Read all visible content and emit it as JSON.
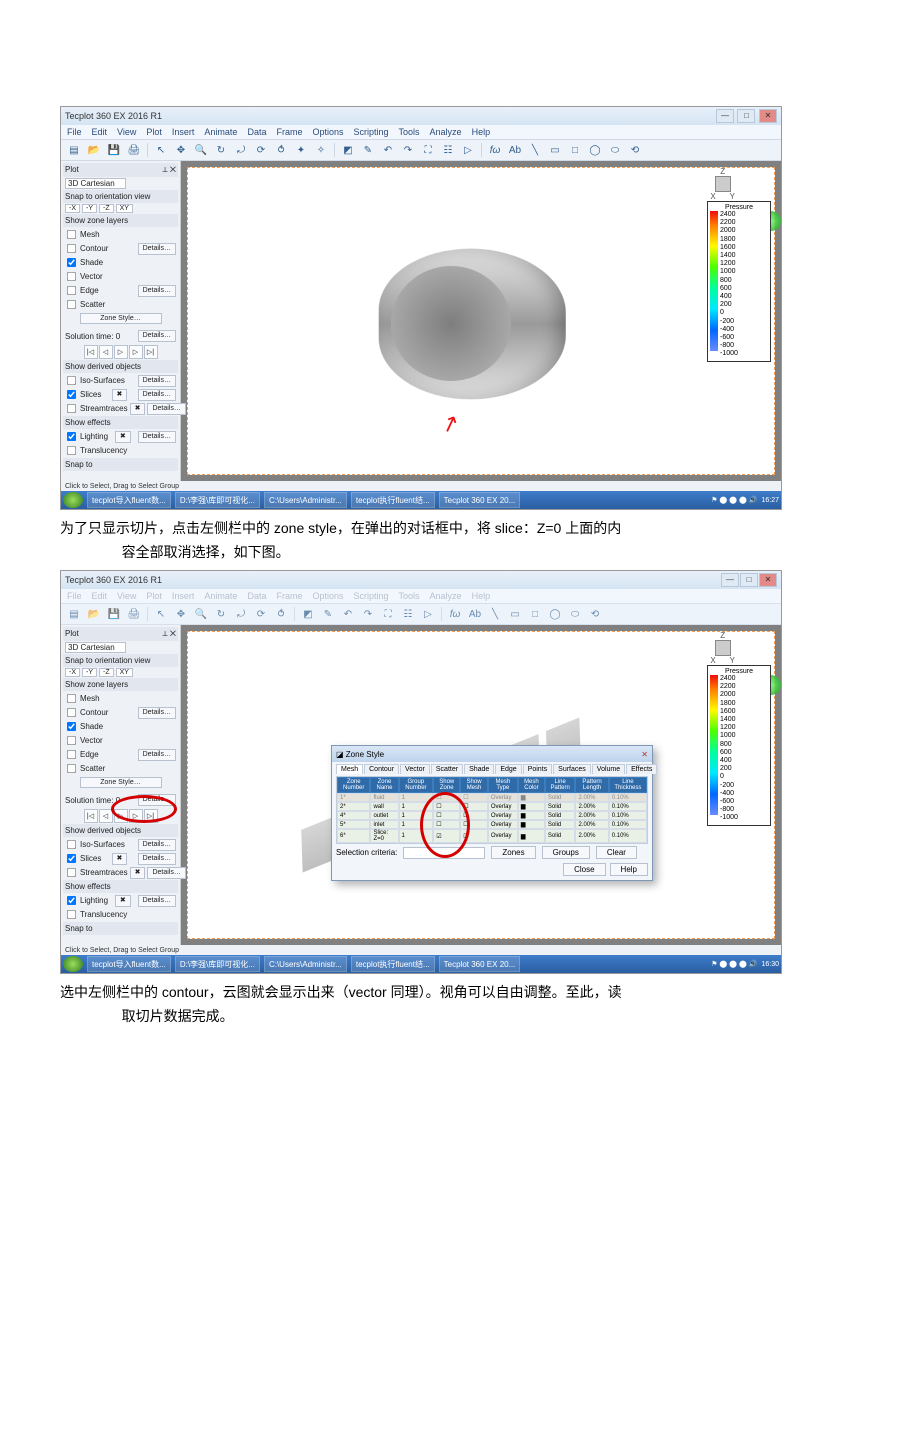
{
  "app": {
    "title": "Tecplot 360 EX 2016 R1"
  },
  "menus": [
    "File",
    "Edit",
    "View",
    "Plot",
    "Insert",
    "Animate",
    "Data",
    "Frame",
    "Options",
    "Scripting",
    "Tools",
    "Analyze",
    "Help"
  ],
  "sidebar": {
    "plot_panel": "Plot",
    "plot_type": "3D Cartesian",
    "snap_label": "Snap to orientation view",
    "orient": [
      "-X",
      "-Y",
      "-Z",
      "XY"
    ],
    "layers_hdr": "Show zone layers",
    "layers": [
      {
        "label": "Mesh",
        "checked": false,
        "details": false
      },
      {
        "label": "Contour",
        "checked": false,
        "details": true
      },
      {
        "label": "Shade",
        "checked": true,
        "details": false
      },
      {
        "label": "Vector",
        "checked": false,
        "details": false
      },
      {
        "label": "Edge",
        "checked": false,
        "details": true
      },
      {
        "label": "Scatter",
        "checked": false,
        "details": false
      }
    ],
    "zone_style_btn": "Zone Style…",
    "solution_time": "Solution time: 0",
    "details": "Details…",
    "derived_hdr": "Show derived objects",
    "derived": [
      {
        "label": "Iso-Surfaces",
        "checked": false
      },
      {
        "label": "Slices",
        "checked": true
      },
      {
        "label": "Streamtraces",
        "checked": false
      }
    ],
    "effects_hdr": "Show effects",
    "effects": [
      {
        "label": "Lighting",
        "checked": true
      },
      {
        "label": "Translucency",
        "checked": false
      }
    ],
    "snap_to": "Snap to"
  },
  "status": "Click to Select, Drag to Select Group",
  "taskbar_items": [
    "tecplot导入fluent数...",
    "D:\\李强\\库即可视化...",
    "C:\\Users\\Administr...",
    "tecplot执行fluent结...",
    "Tecplot 360 EX 20..."
  ],
  "times": [
    "16:27",
    "16:30"
  ],
  "legend": {
    "title": "Pressure",
    "ticks": [
      "2400",
      "2200",
      "2000",
      "1800",
      "1600",
      "1400",
      "1200",
      "1000",
      "800",
      "600",
      "400",
      "200",
      "0",
      "-200",
      "-400",
      "-600",
      "-800",
      "-1000"
    ]
  },
  "axes": {
    "z": "Z",
    "y": "Y",
    "x": "X"
  },
  "caption1_a": "为了只显示切片，点击左侧栏中的 zone style，在弹出的对话框中，将 slice：Z=0 上面的内",
  "caption1_b": "容全部取消选择，如下图。",
  "caption2_a": "选中左侧栏中的 contour，云图就会显示出来（vector 同理）。视角可以自由调整。至此，读",
  "caption2_b": "取切片数据完成。",
  "zone_style": {
    "title": "Zone Style",
    "tabs": [
      "Mesh",
      "Contour",
      "Vector",
      "Scatter",
      "Shade",
      "Edge",
      "Points",
      "Surfaces",
      "Volume",
      "Effects"
    ],
    "headers": [
      "Zone Number",
      "Zone Name",
      "Group Number",
      "Show Zone",
      "Show Mesh",
      "Mesh Type",
      "Mesh Color",
      "Line Pattern",
      "Pattern Length",
      "Line Thickness"
    ],
    "rows": [
      {
        "num": "1*",
        "name": "fluid",
        "grp": "1",
        "show": "",
        "mesh": "",
        "type": "Overlay",
        "color": "",
        "pat": "Solid",
        "len": "2.00%",
        "thk": "0.10%",
        "dim": true
      },
      {
        "num": "2*",
        "name": "wall",
        "grp": "1",
        "show": "",
        "mesh": "",
        "type": "Overlay",
        "color": "",
        "pat": "Solid",
        "len": "2.00%",
        "thk": "0.10%",
        "dim": false
      },
      {
        "num": "4*",
        "name": "outlet",
        "grp": "1",
        "show": "",
        "mesh": "",
        "type": "Overlay",
        "color": "",
        "pat": "Solid",
        "len": "2.00%",
        "thk": "0.10%",
        "dim": false
      },
      {
        "num": "5*",
        "name": "inlet",
        "grp": "1",
        "show": "",
        "mesh": "",
        "type": "Overlay",
        "color": "",
        "pat": "Solid",
        "len": "2.00%",
        "thk": "0.10%",
        "dim": false
      },
      {
        "num": "6*",
        "name": "Slice: Z=0",
        "grp": "1",
        "show": "✓",
        "mesh": "",
        "type": "Overlay",
        "color": "",
        "pat": "Solid",
        "len": "2.00%",
        "thk": "0.10%",
        "dim": false
      }
    ],
    "sel_label": "Selection criteria:",
    "btns_row": [
      "Zones",
      "Groups",
      "Clear"
    ],
    "btns_bottom": [
      "Close",
      "Help"
    ]
  }
}
